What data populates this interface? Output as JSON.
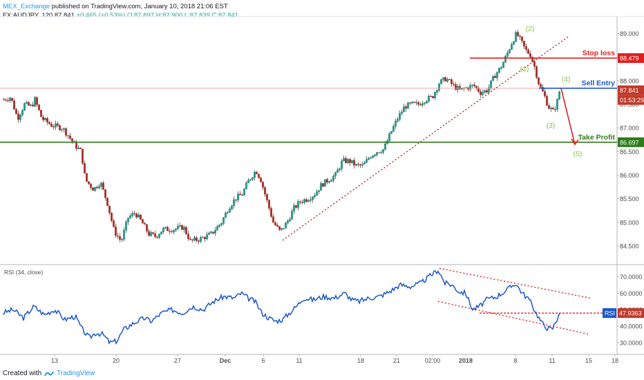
{
  "header": {
    "publisher": "MEX_Exchange",
    "published_text": "published on TradingView.com, January 10, 2018 21:06 EST",
    "symbol": "FX:AUDJPY, 120",
    "last": "87.841",
    "change": "+0.465 (+0.53%)",
    "open": "O:87.897",
    "high": "H:87.900",
    "low": "L:87.839",
    "close": "C:87.841"
  },
  "footer": {
    "created_with": "Created with",
    "brand": "TradingView"
  },
  "colors": {
    "up": "#26a69a",
    "down": "#ef5350",
    "rsi": "#1a56c9",
    "stop": "#e01e1e",
    "entry": "#1a56c9",
    "profit": "#2e7d1a",
    "wave": "#8bc34a"
  },
  "chart_data": [
    {
      "type": "candlestick",
      "symbol": "FX:AUDJPY",
      "timeframe": "120",
      "ylim": [
        84.25,
        89.3
      ],
      "y_ticks": [
        "89.000",
        "88.500",
        "88.000",
        "87.500",
        "87.000",
        "86.500",
        "86.000",
        "85.500",
        "85.000",
        "84.500"
      ],
      "x_ticks": [
        "13",
        "20",
        "27",
        "Dec",
        "6",
        "11",
        "18",
        "21",
        "02:00",
        "2018",
        "8",
        "11",
        "15",
        "18"
      ],
      "price_path": [
        [
          0,
          87.6
        ],
        [
          10,
          87.65
        ],
        [
          20,
          87.2
        ],
        [
          30,
          87.5
        ],
        [
          40,
          87.45
        ],
        [
          45,
          87.6
        ],
        [
          55,
          87.2
        ],
        [
          70,
          87.05
        ],
        [
          85,
          87.0
        ],
        [
          95,
          86.8
        ],
        [
          105,
          86.6
        ],
        [
          112,
          86.5
        ],
        [
          118,
          85.9
        ],
        [
          130,
          85.7
        ],
        [
          140,
          85.85
        ],
        [
          150,
          85.4
        ],
        [
          160,
          84.8
        ],
        [
          170,
          84.6
        ],
        [
          180,
          85.1
        ],
        [
          190,
          85.2
        ],
        [
          200,
          85.0
        ],
        [
          210,
          84.75
        ],
        [
          220,
          84.7
        ],
        [
          230,
          84.85
        ],
        [
          245,
          84.85
        ],
        [
          260,
          84.9
        ],
        [
          270,
          84.6
        ],
        [
          285,
          84.65
        ],
        [
          300,
          84.75
        ],
        [
          315,
          85.0
        ],
        [
          325,
          85.3
        ],
        [
          335,
          85.5
        ],
        [
          345,
          85.6
        ],
        [
          355,
          85.9
        ],
        [
          365,
          86.1
        ],
        [
          372,
          85.9
        ],
        [
          380,
          85.5
        ],
        [
          390,
          85.0
        ],
        [
          400,
          84.8
        ],
        [
          410,
          85.0
        ],
        [
          420,
          85.3
        ],
        [
          430,
          85.45
        ],
        [
          440,
          85.5
        ],
        [
          450,
          85.6
        ],
        [
          460,
          85.8
        ],
        [
          470,
          85.9
        ],
        [
          480,
          86.0
        ],
        [
          490,
          86.3
        ],
        [
          500,
          86.3
        ],
        [
          510,
          86.2
        ],
        [
          520,
          86.2
        ],
        [
          530,
          86.4
        ],
        [
          540,
          86.5
        ],
        [
          550,
          86.55
        ],
        [
          560,
          86.9
        ],
        [
          570,
          87.2
        ],
        [
          580,
          87.45
        ],
        [
          590,
          87.5
        ],
        [
          600,
          87.5
        ],
        [
          610,
          87.6
        ],
        [
          620,
          87.65
        ],
        [
          630,
          87.95
        ],
        [
          640,
          88.05
        ],
        [
          650,
          87.9
        ],
        [
          660,
          87.8
        ],
        [
          670,
          87.85
        ],
        [
          680,
          87.9
        ],
        [
          690,
          87.75
        ],
        [
          700,
          87.8
        ],
        [
          710,
          88.1
        ],
        [
          720,
          88.3
        ],
        [
          728,
          88.55
        ],
        [
          735,
          88.8
        ],
        [
          742,
          89.0
        ],
        [
          748,
          88.85
        ],
        [
          755,
          88.65
        ],
        [
          762,
          88.55
        ],
        [
          768,
          88.3
        ],
        [
          775,
          87.9
        ],
        [
          782,
          87.7
        ],
        [
          788,
          87.45
        ],
        [
          795,
          87.35
        ],
        [
          800,
          87.5
        ],
        [
          805,
          87.84
        ]
      ],
      "horizontal_levels": [
        {
          "label": "Stop loss",
          "value": 88.479
        },
        {
          "label": "Sell Entry",
          "value": 87.841
        },
        {
          "label": "Take Profit",
          "value": 86.697
        }
      ],
      "price_labels": [
        "88.479",
        "87.841",
        "01:53:29",
        "86.697"
      ],
      "trendline": {
        "from": [
          405,
          84.62
        ],
        "to": [
          820,
          88.95
        ]
      },
      "projection": {
        "from": [
          808,
          87.84
        ],
        "to": [
          828,
          86.65
        ]
      },
      "wave_labels": [
        {
          "label": "(1)",
          "x": 755,
          "y": 88.2
        },
        {
          "label": "(2)",
          "x": 763,
          "y": 89.05
        },
        {
          "label": "(3)",
          "x": 793,
          "y": 87.0
        },
        {
          "label": "(4)",
          "x": 815,
          "y": 87.98
        },
        {
          "label": "(5)",
          "x": 832,
          "y": 86.4
        }
      ]
    },
    {
      "type": "line",
      "title": "RSI (34, close)",
      "series": [
        {
          "name": "RSI",
          "last": "47.9363"
        }
      ],
      "ylim": [
        25,
        76
      ],
      "y_ticks": [
        "70.0000",
        "60.0000",
        "50.0000",
        "40.0000",
        "30.0000"
      ],
      "points": [
        [
          0,
          48
        ],
        [
          15,
          50
        ],
        [
          30,
          45
        ],
        [
          45,
          52
        ],
        [
          60,
          47
        ],
        [
          75,
          50
        ],
        [
          90,
          44
        ],
        [
          105,
          46
        ],
        [
          115,
          38
        ],
        [
          125,
          33
        ],
        [
          135,
          36
        ],
        [
          145,
          35
        ],
        [
          155,
          30
        ],
        [
          165,
          31
        ],
        [
          175,
          38
        ],
        [
          190,
          42
        ],
        [
          205,
          45
        ],
        [
          215,
          43
        ],
        [
          230,
          48
        ],
        [
          245,
          50
        ],
        [
          260,
          48
        ],
        [
          275,
          52
        ],
        [
          290,
          50
        ],
        [
          305,
          55
        ],
        [
          320,
          58
        ],
        [
          335,
          57
        ],
        [
          345,
          60
        ],
        [
          355,
          57
        ],
        [
          365,
          55
        ],
        [
          375,
          48
        ],
        [
          385,
          45
        ],
        [
          395,
          43
        ],
        [
          405,
          44
        ],
        [
          415,
          48
        ],
        [
          425,
          52
        ],
        [
          435,
          57
        ],
        [
          450,
          56
        ],
        [
          465,
          58
        ],
        [
          480,
          57
        ],
        [
          495,
          60
        ],
        [
          505,
          56
        ],
        [
          515,
          55
        ],
        [
          530,
          57
        ],
        [
          545,
          58
        ],
        [
          560,
          61
        ],
        [
          575,
          65
        ],
        [
          590,
          64
        ],
        [
          605,
          66
        ],
        [
          620,
          71
        ],
        [
          630,
          74
        ],
        [
          640,
          66
        ],
        [
          650,
          65
        ],
        [
          660,
          61
        ],
        [
          670,
          60
        ],
        [
          680,
          50
        ],
        [
          690,
          52
        ],
        [
          700,
          56
        ],
        [
          715,
          58
        ],
        [
          730,
          62
        ],
        [
          742,
          66
        ],
        [
          752,
          60
        ],
        [
          762,
          56
        ],
        [
          772,
          48
        ],
        [
          780,
          42
        ],
        [
          788,
          39
        ],
        [
          795,
          38
        ],
        [
          802,
          44
        ],
        [
          806,
          47.9
        ]
      ],
      "upper_channel": {
        "from": [
          632,
          75
        ],
        "to": [
          850,
          57
        ]
      },
      "lower_channel": {
        "from": [
          630,
          55
        ],
        "to": [
          850,
          35
        ]
      },
      "level_line": {
        "from": [
          690,
          47.9
        ],
        "to": [
          905,
          47.9
        ]
      }
    }
  ]
}
